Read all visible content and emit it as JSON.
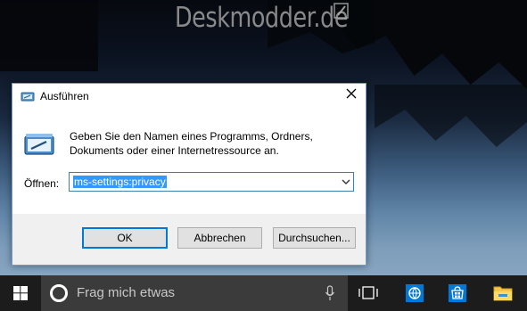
{
  "watermark": {
    "text": "Deskmodder.de"
  },
  "run_dialog": {
    "title": "Ausführen",
    "description": "Geben Sie den Namen eines Programms, Ordners, Dokuments oder einer Internetressource an.",
    "open_label": "Öffnen:",
    "open_value": "ms-settings:privacy",
    "buttons": {
      "ok": "OK",
      "cancel": "Abbrechen",
      "browse": "Durchsuchen..."
    }
  },
  "taskbar": {
    "search_placeholder": "Frag mich etwas",
    "apps": [
      "internet-explorer",
      "store",
      "file-explorer"
    ]
  },
  "colors": {
    "accent": "#0078d7",
    "selection": "#3399ff",
    "taskbar": "#1c1c1c",
    "search_box": "#3b3b3b"
  }
}
